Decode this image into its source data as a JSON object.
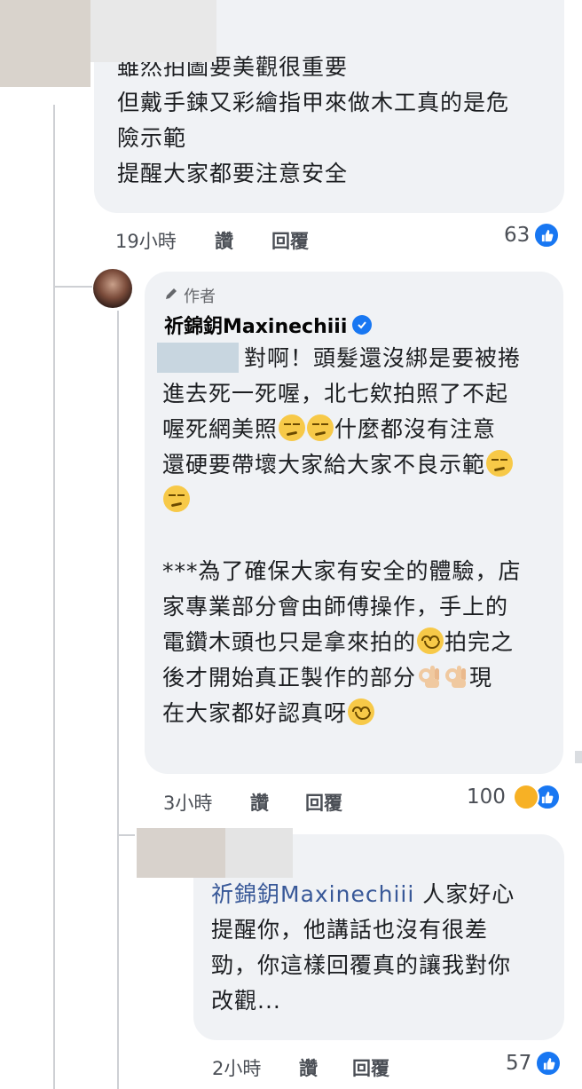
{
  "comment1": {
    "lines": [
      "雖然拍圖要美觀很重要",
      "但戴手鍊又彩繪指甲來做木工真的是危",
      "險示範",
      "提醒大家都要注意安全"
    ],
    "time": "19小時",
    "like": "讚",
    "reply": "回覆",
    "reaction_count": "63"
  },
  "comment2": {
    "badge": "作者",
    "author": "祈錦鈅Maxinechiii",
    "lines": [
      "對啊！頭髮還沒綁是要被捲",
      "進去死一死喔，北七欸拍照了不起",
      "喔死網美照",
      "什麼都沒有注意",
      "還硬要帶壞大家給大家不良示範",
      "***為了確保大家有安全的體驗，店",
      "家專業部分會由師傅操作，手上的",
      "電鑽木頭也只是拿來拍的",
      "拍完之",
      "後才開始真正製作的部分",
      "現",
      "在大家都好認真呀"
    ],
    "time": "3小時",
    "like": "讚",
    "reply": "回覆",
    "reaction_count": "100",
    "emojis": [
      "smirk-emoji",
      "relieved-emoji",
      "ok-hand-emoji",
      "smile-emoji"
    ]
  },
  "comment3": {
    "mention": "祈錦鈅Maxinechiii",
    "line1_rest": " 人家好心",
    "lines": [
      "提醒你，他講話也沒有很差",
      "勁，你這樣回覆真的讓我對你",
      "改觀..."
    ],
    "time": "2小時",
    "like": "讚",
    "reply": "回覆",
    "reaction_count": "57"
  },
  "colors": {
    "bubble": "#f0f2f5",
    "like_blue": "#1877f2",
    "haha_yellow": "#f7b125",
    "mention": "#385898"
  }
}
